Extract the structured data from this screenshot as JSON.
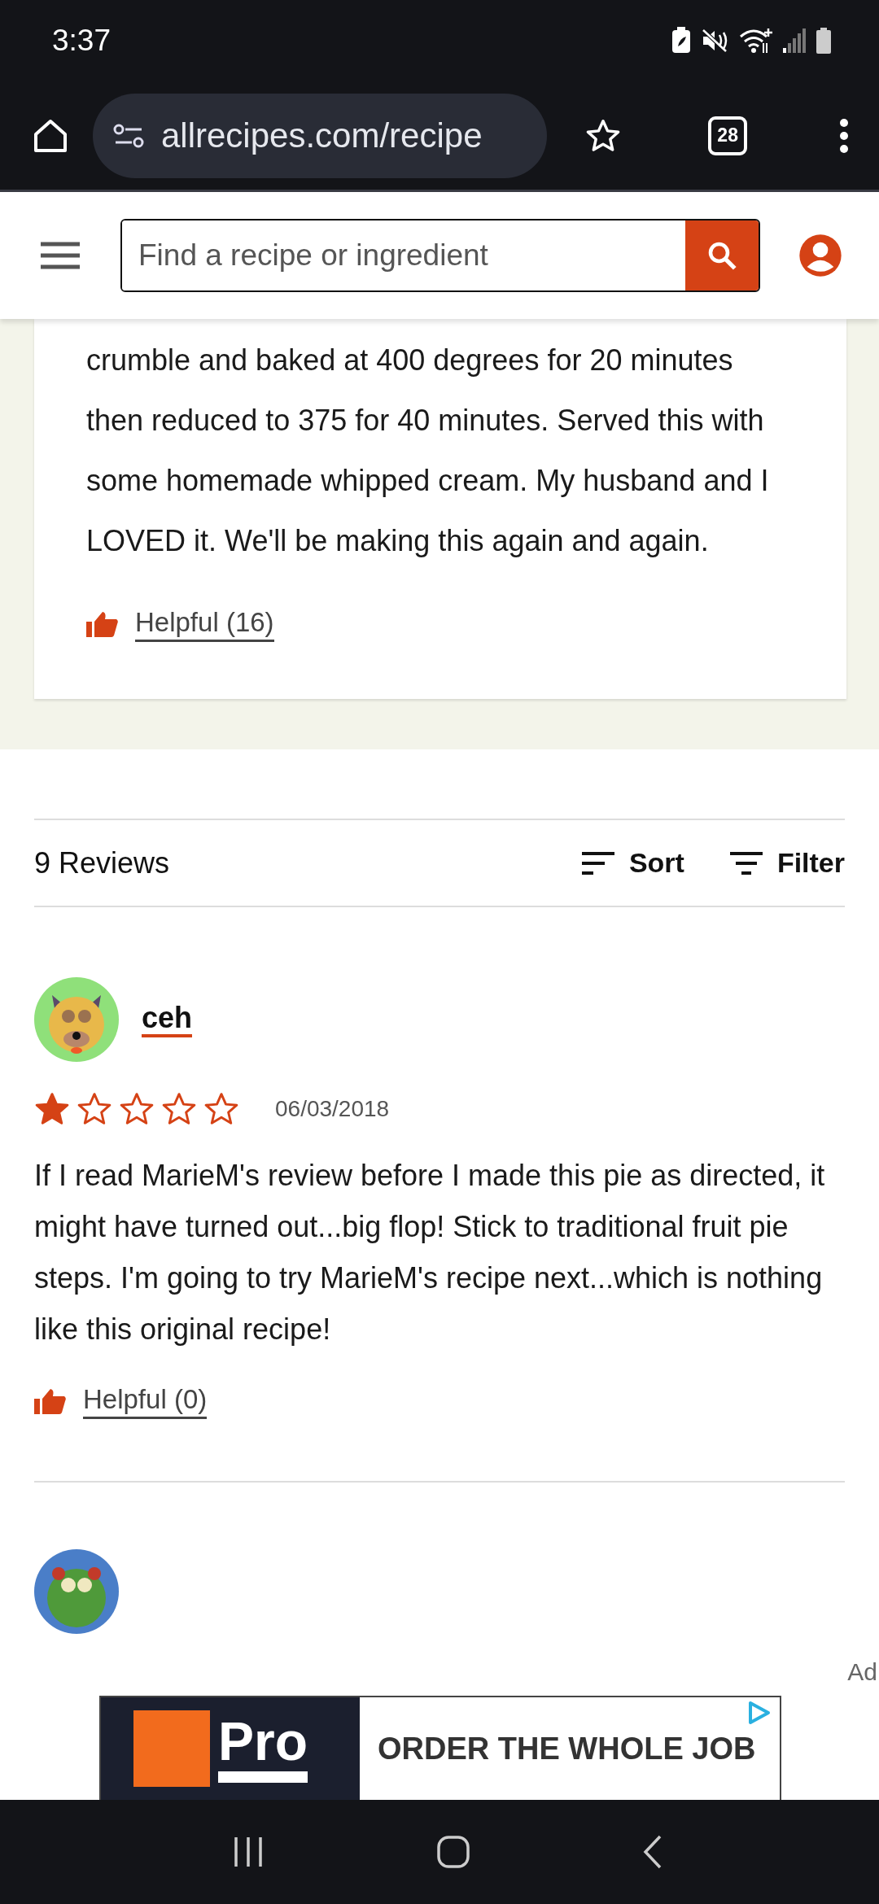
{
  "status_bar": {
    "time": "3:37"
  },
  "browser": {
    "url": "allrecipes.com/recipe",
    "tab_count": "28"
  },
  "site_header": {
    "search": {
      "placeholder": "Find a recipe or ingredient"
    }
  },
  "featured_review": {
    "text": "crumble and baked at 400 degrees for 20 minutes then reduced to 375 for 40 minutes. Served this with some homemade whipped cream. My husband and I LOVED it. We'll be making this again and again.",
    "helpful": "Helpful (16)"
  },
  "reviews_header": {
    "count": "9 Reviews",
    "sort": "Sort",
    "filter": "Filter"
  },
  "reviews": [
    {
      "author": "ceh",
      "stars": 1,
      "date": "06/03/2018",
      "text": "If I read MarieM's review before I made this pie as directed, it might have turned out...big flop! Stick to traditional fruit pie steps. I'm going to try MarieM's recipe next...which is nothing like this original recipe!",
      "helpful": "Helpful (0)"
    }
  ],
  "ad": {
    "label": "Ad",
    "brand": "Pro",
    "headline": "ORDER THE WHOLE JOB"
  }
}
